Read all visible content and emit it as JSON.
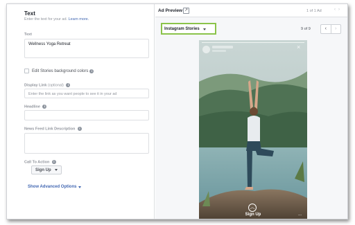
{
  "left": {
    "section_title": "Text",
    "section_subtitle": "Enter the text for your ad.",
    "learn_more": "Learn more.",
    "text_label": "Text",
    "text_value": "Wellness Yoga Retreat",
    "edit_stories_label": "Edit Stories background colors",
    "display_link_label": "Display Link",
    "display_link_optional": "(optional)",
    "display_link_placeholder": "Enter the link as you want people to see it in your ad",
    "headline_label": "Headline",
    "headline_value": "",
    "news_feed_label": "News Feed Link Description",
    "news_feed_value": "",
    "cta_label": "Call To Action",
    "cta_value": "Sign Up",
    "advanced_options": "Show Advanced Options"
  },
  "right": {
    "preview_title": "Ad Preview",
    "ad_count": "1 of 1 Ad",
    "placement_value": "Instagram Stories",
    "page_count": "9 of 9",
    "story_cta": "Sign Up",
    "story_more": "..."
  },
  "icons": {
    "info": "info-icon",
    "external": "external-link-icon",
    "caret": "caret-down-icon",
    "prev": "chevron-left-icon",
    "next": "chevron-right-icon",
    "close": "close-icon",
    "swipe_up": "chevron-up-icon"
  },
  "colors": {
    "accent_link": "#4267b2",
    "highlight_border": "#8bc34a"
  }
}
